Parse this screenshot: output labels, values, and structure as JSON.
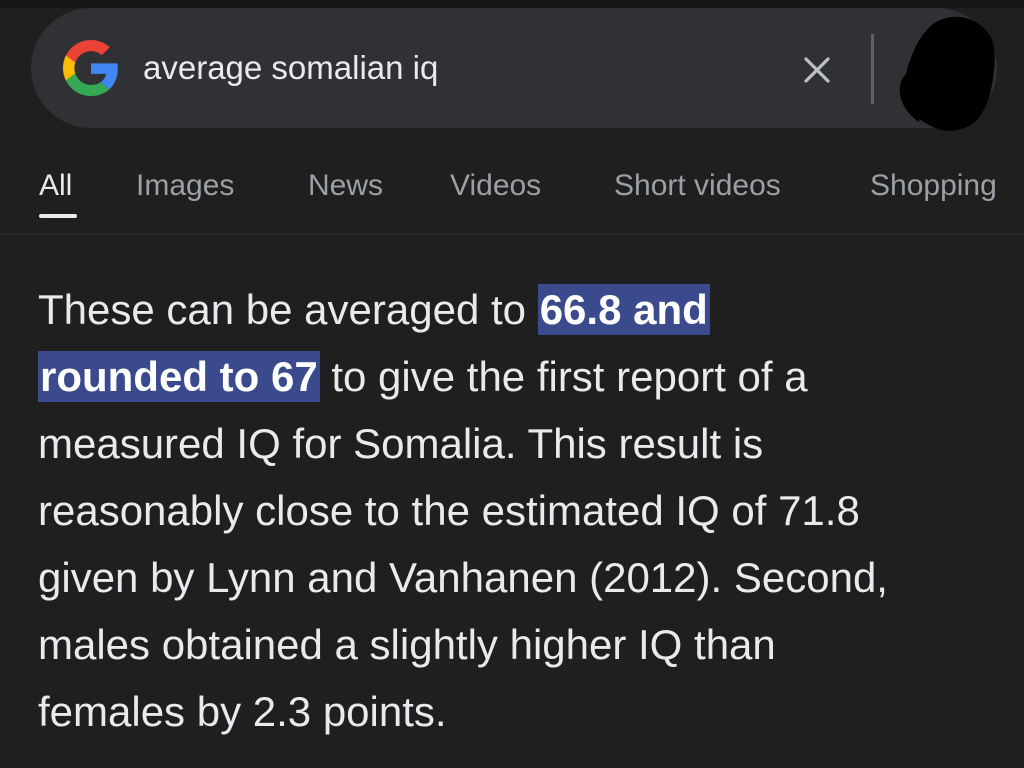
{
  "search": {
    "query": "average somalian iq"
  },
  "tabs": [
    {
      "label": "All",
      "active": true
    },
    {
      "label": "Images",
      "active": false
    },
    {
      "label": "News",
      "active": false
    },
    {
      "label": "Videos",
      "active": false
    },
    {
      "label": "Short videos",
      "active": false
    },
    {
      "label": "Shopping",
      "active": false
    }
  ],
  "snippet": {
    "highlight_line1": "66.8 and",
    "highlight_line2": "rounded to 67",
    "lines": [
      "These can be averaged to ",
      " to give the first report of a",
      "measured IQ for Somalia. This result is",
      "reasonably close to the estimated IQ of 71.8",
      "given by Lynn and Vanhanen (2012). Second,",
      "males obtained a slightly higher IQ than",
      "females by 2.3 points."
    ]
  },
  "icons": {
    "logo": "google-g-icon",
    "clear": "close-icon",
    "avatar": "redacted-avatar"
  },
  "colors": {
    "background": "#1f1f1f",
    "searchbar": "#303134",
    "highlight": "#3b4a8c",
    "text": "#e8eaed",
    "muted_text": "#9aa0a6"
  }
}
